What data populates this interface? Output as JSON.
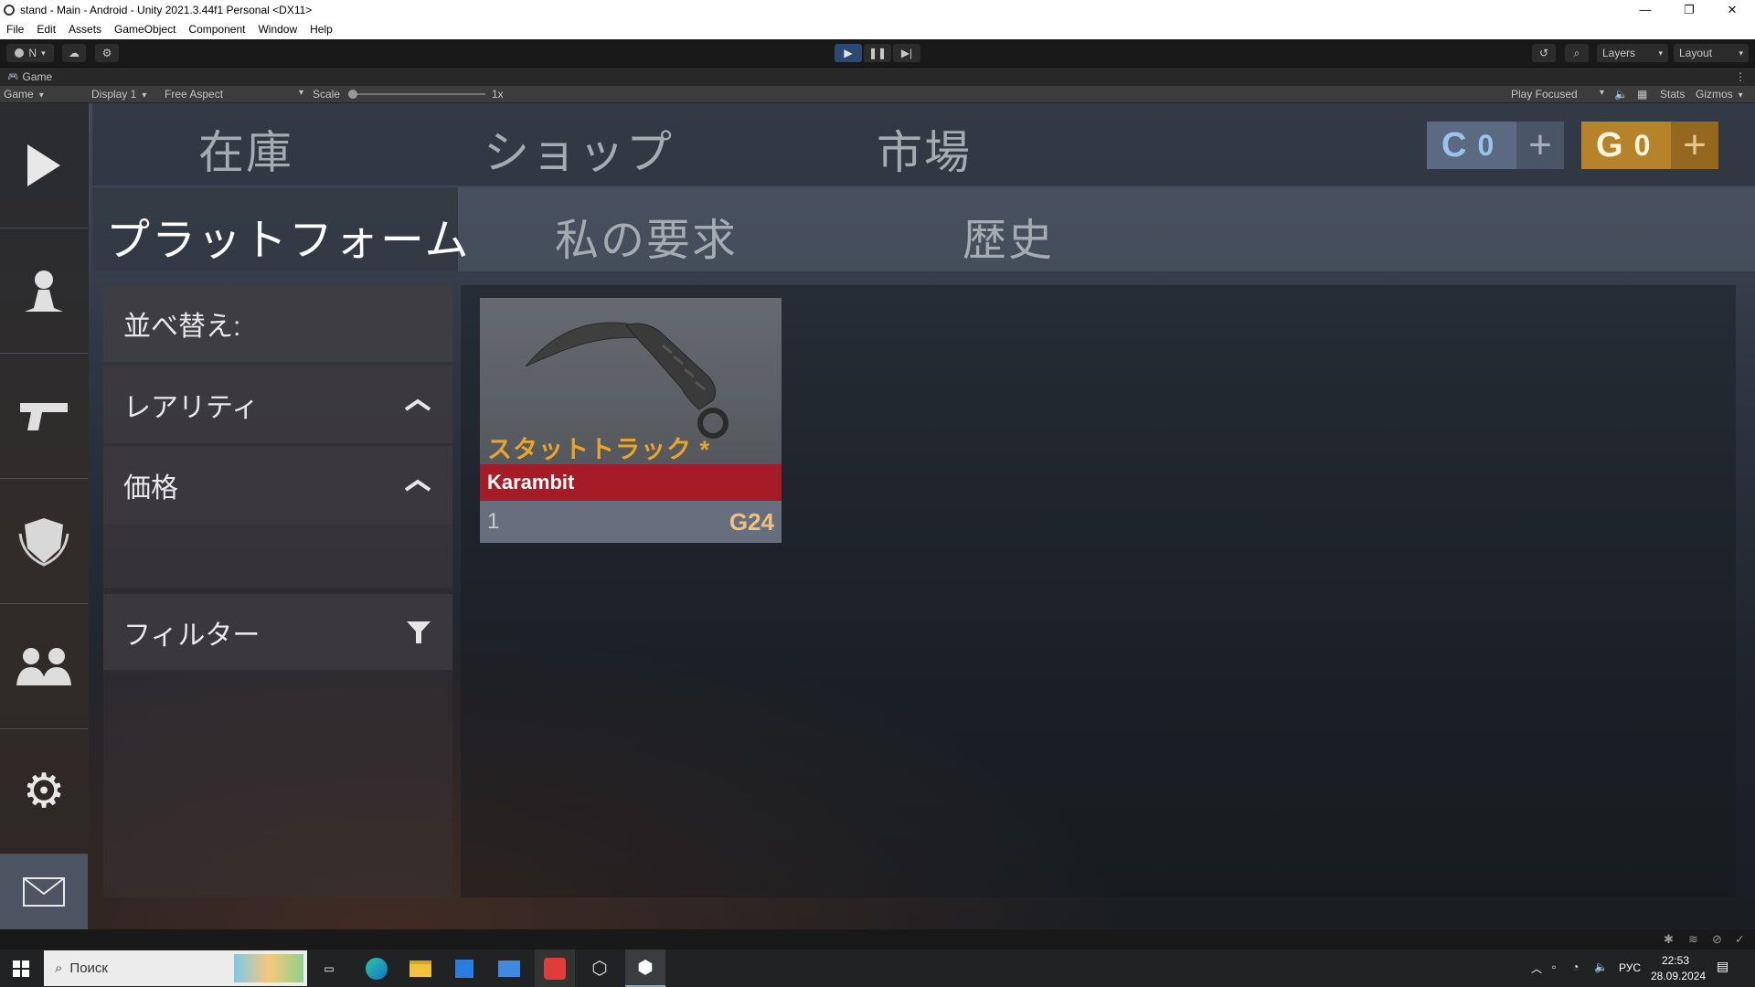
{
  "window": {
    "title": "stand - Main - Android - Unity 2021.3.44f1 Personal <DX11>"
  },
  "menu": [
    "File",
    "Edit",
    "Assets",
    "GameObject",
    "Component",
    "Window",
    "Help"
  ],
  "toolbar": {
    "account": "N",
    "layers": "Layers",
    "layout": "Layout"
  },
  "game_tab": {
    "label": "Game"
  },
  "game_options": {
    "view": "Game",
    "display": "Display 1",
    "aspect": "Free Aspect",
    "scale_label": "Scale",
    "scale_value": "1x",
    "play_mode": "Play Focused",
    "stats": "Stats",
    "gizmos": "Gizmos"
  },
  "nav": {
    "tabs": [
      "在庫",
      "ショップ",
      "市場"
    ]
  },
  "currency": {
    "silver": {
      "symbol": "C",
      "amount": "0",
      "plus": "+",
      "color": "#5b6a82"
    },
    "gold": {
      "symbol": "G",
      "amount": "0",
      "plus": "+",
      "color": "#b6832a"
    }
  },
  "subnav": {
    "tabs": [
      "プラットフォーム",
      "私の要求",
      "歴史"
    ],
    "active": 0
  },
  "filters": {
    "sort_label": "並べ替え:",
    "rarity": "レアリティ",
    "price": "価格",
    "filter": "フィルター"
  },
  "listing": {
    "stattrak": "スタットトラック *",
    "name": "Karambit",
    "quantity": "1",
    "price": "G24",
    "name_color": "#a51c26"
  },
  "taskbar": {
    "search_placeholder": "Поиск",
    "lang": "РУС",
    "time": "22:53",
    "date": "28.09.2024"
  }
}
